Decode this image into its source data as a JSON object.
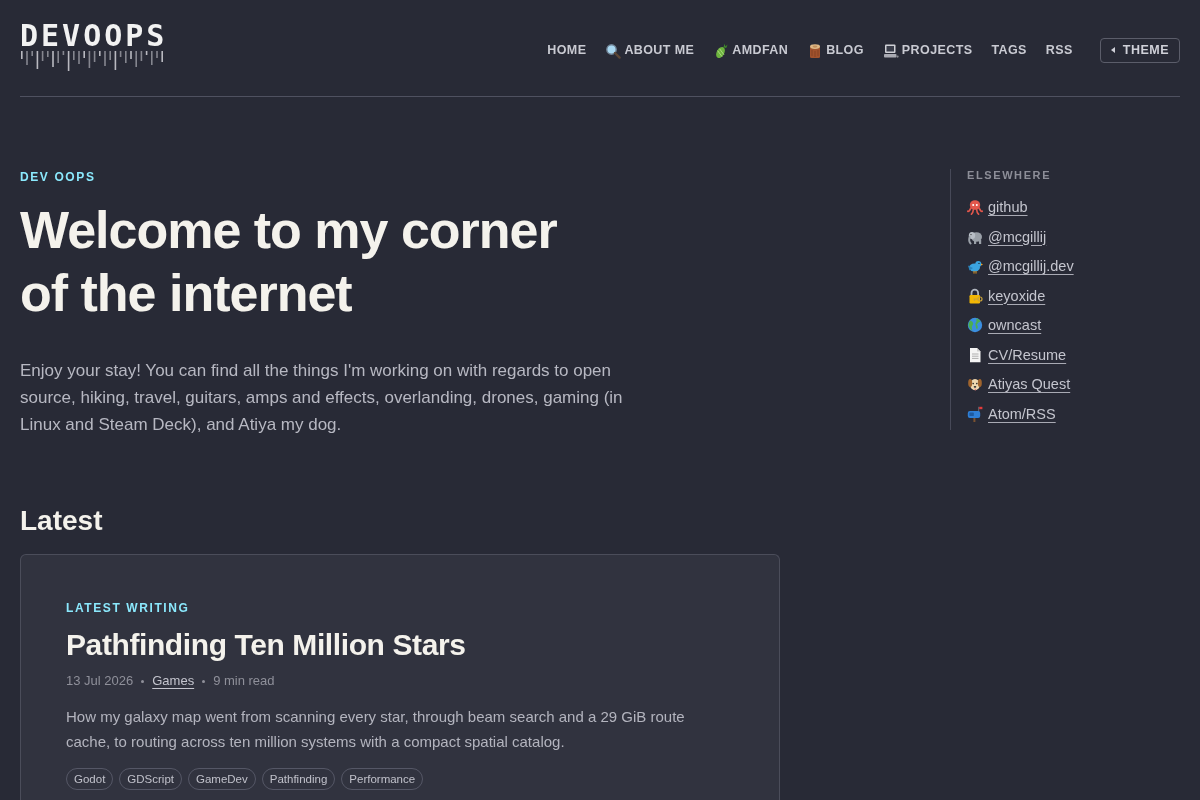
{
  "header": {
    "logo": "DEVOOPS",
    "nav": [
      {
        "label": "HOME"
      },
      {
        "label": "ABOUT ME"
      },
      {
        "label": "AMDFAN"
      },
      {
        "label": "BLOG"
      },
      {
        "label": "PROJECTS"
      },
      {
        "label": "TAGS"
      },
      {
        "label": "RSS"
      }
    ],
    "theme_button": {
      "label": "THEME"
    }
  },
  "hero": {
    "eyebrow": "DEV OOPS",
    "title": "Welcome to my corner of the internet",
    "intro": "Enjoy your stay! You can find all the things I'm working on with regards to open source, hiking, travel, guitars, amps and effects, overlanding, drones, gaming (in Linux and Steam Deck), and Atiya my dog."
  },
  "latest": {
    "heading": "Latest",
    "card": {
      "eyebrow": "LATEST WRITING",
      "title": "Pathfinding Ten Million Stars",
      "date": "13 Jul 2026",
      "category": "Games",
      "read_time": "9 min read",
      "summary": "How my galaxy map went from scanning every star, through beam search and a 29 GiB route cache, to routing across ten million systems with a compact spatial catalog.",
      "tags": [
        "Godot",
        "GDScript",
        "GameDev",
        "Pathfinding",
        "Performance"
      ]
    }
  },
  "sidebar": {
    "heading": "ELSEWHERE",
    "links": [
      {
        "label": "github"
      },
      {
        "label": "@mcgillij"
      },
      {
        "label": "@mcgillij.dev"
      },
      {
        "label": "keyoxide"
      },
      {
        "label": "owncast"
      },
      {
        "label": "CV/Resume"
      },
      {
        "label": "Atiyas Quest"
      },
      {
        "label": "Atom/RSS"
      }
    ]
  }
}
